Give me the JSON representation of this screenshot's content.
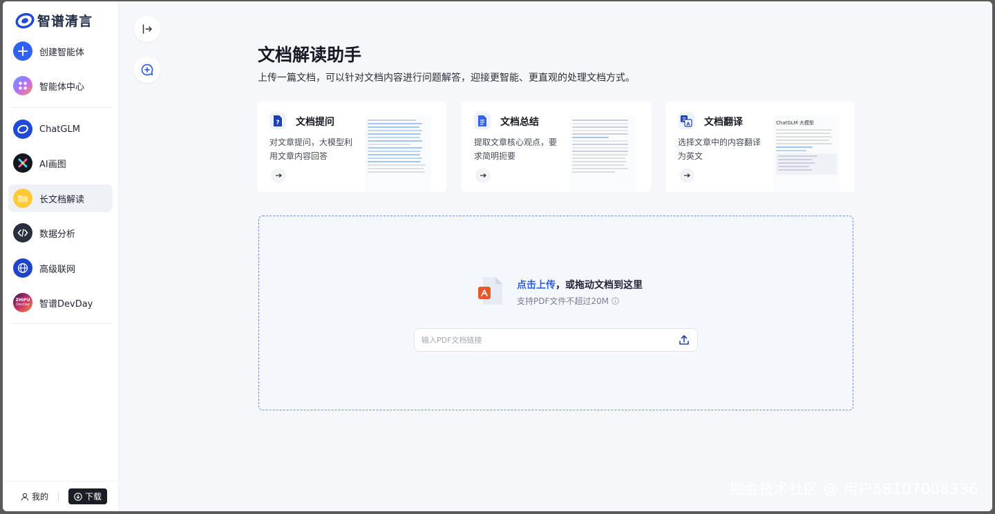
{
  "app": {
    "name": "智谱清言"
  },
  "sidebar": {
    "items": [
      {
        "label": "创建智能体"
      },
      {
        "label": "智能体中心"
      },
      {
        "label": "ChatGLM"
      },
      {
        "label": "AI画图"
      },
      {
        "label": "长文档解读"
      },
      {
        "label": "数据分析"
      },
      {
        "label": "高级联网"
      },
      {
        "label": "智谱DevDay",
        "badge_top": "ZHIPU",
        "badge_bottom": "DevDay"
      }
    ],
    "active_index": 4,
    "bottom": {
      "my_label": "我的",
      "download_label": "下载"
    }
  },
  "main": {
    "title": "文档解读助手",
    "subtitle": "上传一篇文档，可以针对文档内容进行问题解答，迎接更智能、更直观的处理文档方式。",
    "cards": [
      {
        "title": "文档提问",
        "desc": "对文章提问，大模型利用文章内容回答"
      },
      {
        "title": "文档总结",
        "desc": "提取文章核心观点，要求简明扼要"
      },
      {
        "title": "文档翻译",
        "desc": "选择文章中的内容翻译为英文",
        "thumb_title": "ChatGLM 大模型"
      }
    ],
    "upload": {
      "link_text": "点击上传",
      "rest_text": "，或拖动文档到这里",
      "hint": "支持PDF文件不超过20M",
      "url_placeholder": "输入PDF文档链接"
    }
  },
  "credit": "掘金技术社区 @ 用户58107008336",
  "colors": {
    "accent": "#2f5fe0",
    "pdf": "#e8572c",
    "active_bg": "#eef1f6"
  }
}
